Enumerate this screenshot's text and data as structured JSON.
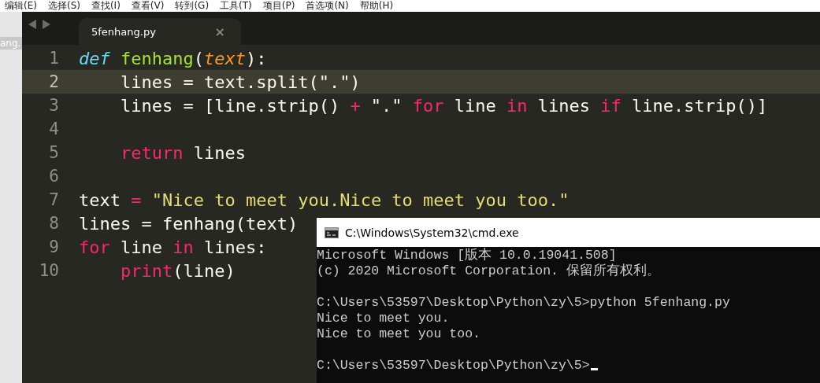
{
  "menu": [
    "编辑(E)",
    "选择(S)",
    "查找(I)",
    "查看(V)",
    "转到(G)",
    "工具(T)",
    "项目(P)",
    "首选项(N)",
    "帮助(H)"
  ],
  "side_tab": {
    "label": "ang."
  },
  "editor": {
    "tabs": [
      {
        "label": "5fenhang.py",
        "close": "×",
        "selected": true
      }
    ],
    "lines": [
      {
        "number": "1",
        "highlighted": false,
        "tokens": [
          {
            "text": "def ",
            "kind": "storage"
          },
          {
            "text": "fenhang",
            "kind": "function"
          },
          {
            "text": "(",
            "kind": "plain"
          },
          {
            "text": "text",
            "kind": "param"
          },
          {
            "text": "):",
            "kind": "plain"
          }
        ]
      },
      {
        "number": "2",
        "highlighted": true,
        "tokens": [
          {
            "text": "    lines = text.split(\".\")",
            "kind": "plain"
          }
        ]
      },
      {
        "number": "3",
        "highlighted": false,
        "tokens": [
          {
            "text": "    lines = [line.strip() ",
            "kind": "plain"
          },
          {
            "text": "+",
            "kind": "keyword"
          },
          {
            "text": " \".\" ",
            "kind": "plain"
          },
          {
            "text": "for",
            "kind": "keyword"
          },
          {
            "text": " line ",
            "kind": "plain"
          },
          {
            "text": "in",
            "kind": "keyword"
          },
          {
            "text": " lines ",
            "kind": "plain"
          },
          {
            "text": "if",
            "kind": "keyword"
          },
          {
            "text": " line.strip()]",
            "kind": "plain"
          }
        ]
      },
      {
        "number": "4",
        "highlighted": false
      },
      {
        "number": "5",
        "highlighted": false,
        "tokens": [
          {
            "text": "    return",
            "kind": "keyword"
          },
          {
            "text": " lines",
            "kind": "plain"
          }
        ]
      },
      {
        "number": "6",
        "highlighted": false
      },
      {
        "number": "7",
        "highlighted": false,
        "tokens": [
          {
            "text": "text ",
            "kind": "plain"
          },
          {
            "text": "= ",
            "kind": "keyword"
          },
          {
            "text": "\"Nice to meet you.Nice to meet you too.\"",
            "kind": "string"
          }
        ]
      },
      {
        "number": "8",
        "highlighted": false,
        "tokens": [
          {
            "text": "lines = fenhang(text)",
            "kind": "plain"
          }
        ]
      },
      {
        "number": "9",
        "highlighted": false,
        "tokens": [
          {
            "text": "for",
            "kind": "keyword"
          },
          {
            "text": " line ",
            "kind": "plain"
          },
          {
            "text": "in",
            "kind": "keyword"
          },
          {
            "text": " lines:",
            "kind": "plain"
          }
        ]
      },
      {
        "number": "10",
        "highlighted": false,
        "tokens": [
          {
            "text": "    print",
            "kind": "builtin"
          },
          {
            "text": "(line)",
            "kind": "plain"
          }
        ]
      }
    ]
  },
  "console": {
    "title": "C:\\Windows\\System32\\cmd.exe",
    "blocks": [
      [
        "Microsoft Windows [版本 10.0.19041.508]",
        "(c) 2020 Microsoft Corporation. 保留所有权利。"
      ],
      [
        "C:\\Users\\53597\\Desktop\\Python\\zy\\5>python 5fenhang.py",
        "Nice to meet you.",
        "Nice to meet you too."
      ]
    ],
    "prompt": "C:\\Users\\53597\\Desktop\\Python\\zy\\5>"
  }
}
